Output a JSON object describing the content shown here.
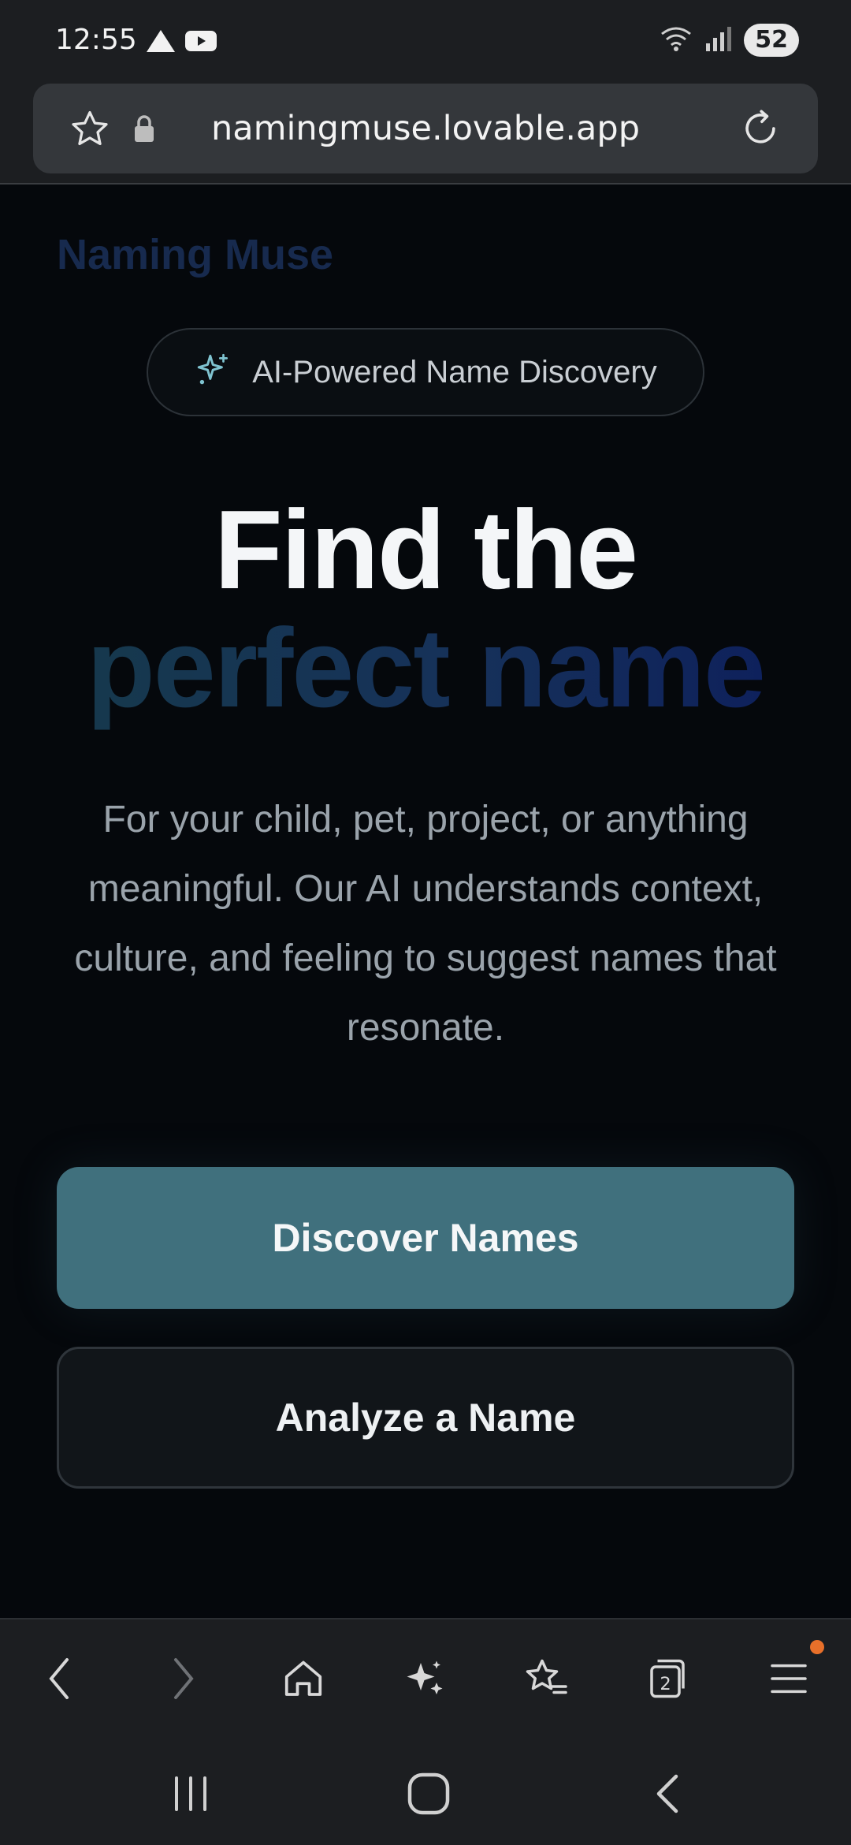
{
  "status_bar": {
    "time": "12:55",
    "battery": "52",
    "icons": [
      "navigation-icon",
      "youtube-icon",
      "wifi-icon",
      "signal-icon"
    ]
  },
  "browser": {
    "url": "namingmuse.lovable.app"
  },
  "page": {
    "brand": "Naming Muse",
    "badge_label": "AI-Powered Name Discovery",
    "headline_line1": "Find the",
    "headline_line2": "perfect name",
    "subtitle": "For your child, pet, project, or anything meaningful. Our AI understands context, culture, and feeling to suggest names that resonate.",
    "primary_button": "Discover Names",
    "secondary_button": "Analyze a Name"
  },
  "browser_nav": {
    "tab_count": "2",
    "items": [
      "back-icon",
      "forward-icon",
      "home-icon",
      "assistant-icon",
      "bookmarks-icon",
      "tabs-icon",
      "menu-icon"
    ]
  },
  "colors": {
    "accent": "#40707d",
    "brand": "#172a4e",
    "notification": "#e8702a"
  }
}
